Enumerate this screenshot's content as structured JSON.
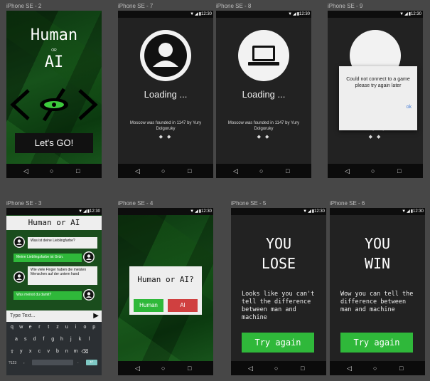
{
  "labels": {
    "s2": "iPhone SE - 2",
    "s7": "iPhone SE - 7",
    "s8": "iPhone SE - 8",
    "s9": "iPhone SE - 9",
    "s3": "iPhone SE - 3",
    "s4": "iPhone SE - 4",
    "s5": "iPhone SE - 5",
    "s6": "iPhone SE - 6"
  },
  "status": {
    "time": "12:30"
  },
  "nav": {
    "back": "◁",
    "home": "○",
    "recent": "□"
  },
  "home": {
    "title_line1": "Human",
    "title_or": "OR",
    "title_line2": "AI",
    "lets_go": "Let's GO!"
  },
  "loading": {
    "text": "Loading ...",
    "fact": "Moscow was founded in 1147 by Yury Dolgoruky",
    "dots": "◆ ◆"
  },
  "error": {
    "message": "Could not connect to a game please try again later",
    "ok": "ok"
  },
  "chat": {
    "header": "Human or AI",
    "messages": [
      {
        "side": "left",
        "text": "Was ist deine Lieblingfarbe?"
      },
      {
        "side": "right",
        "text": "Meine Lieblingsfarbe ist Grün."
      },
      {
        "side": "left",
        "text": "Wie viele Finger haben die meisten Menschen auf der untern hand"
      },
      {
        "side": "right",
        "text": "Was meinst du damit?"
      }
    ],
    "input_placeholder": "Type Text...",
    "send": "▶",
    "keyboard_rows": [
      [
        "q",
        "w",
        "e",
        "r",
        "t",
        "z",
        "u",
        "i",
        "o",
        "p"
      ],
      [
        "a",
        "s",
        "d",
        "f",
        "g",
        "h",
        "j",
        "k",
        "l"
      ],
      [
        "⇧",
        "y",
        "x",
        "c",
        "v",
        "b",
        "n",
        "m",
        "⌫"
      ]
    ],
    "keyboard_bottom": {
      "left": "?123",
      "comma": ",",
      "period": ".",
      "enter": "↵"
    }
  },
  "choice": {
    "question": "Human or AI?",
    "human_button": "Human",
    "ai_button": "AI"
  },
  "lose": {
    "line1": "YOU",
    "line2": "LOSE",
    "message": "Looks like you can't tell the difference between man and machine",
    "button": "Try again"
  },
  "win": {
    "line1": "YOU",
    "line2": "WIN",
    "message": "Wow you can tell the difference between man and machine",
    "button": "Try again"
  },
  "colors": {
    "green": "#2fb83a",
    "red": "#d04040",
    "screen_dark": "#222222"
  }
}
